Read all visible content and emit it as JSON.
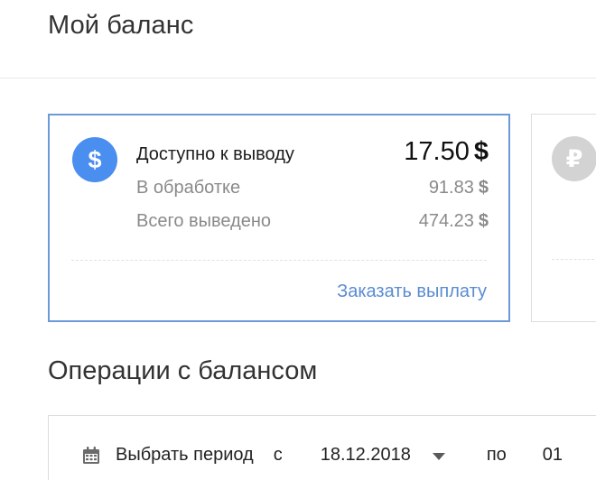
{
  "page": {
    "title": "Мой баланс"
  },
  "balance_usd": {
    "icon": "dollar-icon",
    "icon_glyph": "$",
    "accent_color": "#4a8ef0",
    "available_label": "Доступно к выводу",
    "available_value": "17.50",
    "processing_label": "В обработке",
    "processing_value": "91.83",
    "withdrawn_label": "Всего выведено",
    "withdrawn_value": "474.23",
    "currency_symbol": "$",
    "payout_link": "Заказать выплату"
  },
  "balance_rub": {
    "icon": "ruble-icon",
    "icon_glyph": "₽"
  },
  "operations": {
    "title": "Операции с балансом",
    "filter": {
      "icon": "calendar-icon",
      "period_label": "Выбрать период",
      "from_label": "с",
      "date_from": "18.12.2018",
      "to_label": "по",
      "date_to": "01"
    }
  }
}
